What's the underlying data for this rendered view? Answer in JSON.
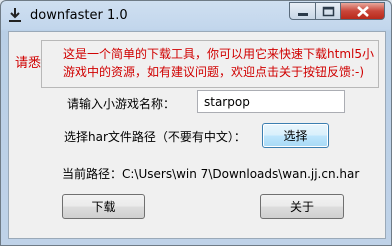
{
  "window": {
    "title": "downfaster 1.0",
    "app_icon": "download-icon"
  },
  "notice": {
    "label": "请悉知",
    "text": "这是一个简单的下载工具，你可以用它来快速下载html5小游戏中的资源，如有建议问题，欢迎点击关于按钮反馈:-)"
  },
  "form": {
    "name_label": "请输入小游戏名称：",
    "name_value": "starpop",
    "path_label": "选择har文件路径（不要有中文）：",
    "choose_button": "选择",
    "current_path": "当前路径：C:\\Users\\win 7\\Downloads\\wan.jj.cn.har",
    "download_button": "下载",
    "about_button": "关于"
  },
  "colors": {
    "notice_red": "#d00000",
    "window_frame": "#c2d6ec",
    "close_red": "#c9463a"
  }
}
